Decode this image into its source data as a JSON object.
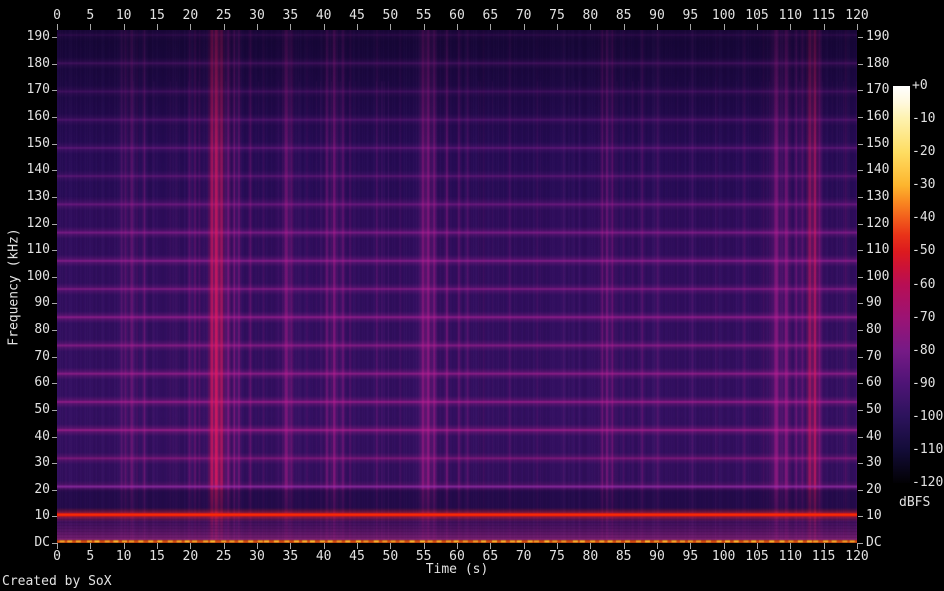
{
  "footer": {
    "credit": "Created by SoX"
  },
  "colors": {
    "background": "#000000",
    "text": "#e2e2e2",
    "tick": "#a8a8a8",
    "plot_background": "#2b0e5c",
    "band_magenta": "#d71e91",
    "hot_red_line": "#f71b07",
    "dc_orange": "#d94f0e",
    "dc_yellow_dash": "#ffcc33"
  },
  "axes": {
    "time": {
      "label": "Time (s)",
      "min": 0,
      "max": 120,
      "ticks": [
        0,
        5,
        10,
        15,
        20,
        25,
        30,
        35,
        40,
        45,
        50,
        55,
        60,
        65,
        70,
        75,
        80,
        85,
        90,
        95,
        100,
        105,
        110,
        115,
        120
      ]
    },
    "freq": {
      "label": "Frequency (kHz)",
      "min": 0,
      "max": 192.7,
      "ticks": [
        "190",
        "180",
        "170",
        "160",
        "150",
        "140",
        "130",
        "120",
        "110",
        "100",
        "90",
        "80",
        "70",
        "60",
        "50",
        "40",
        "30",
        "20",
        "10",
        "DC"
      ]
    }
  },
  "colorbar": {
    "label": "dBFS",
    "ticks": [
      "+0",
      "-10",
      "-20",
      "-30",
      "-40",
      "-50",
      "-60",
      "-70",
      "-80",
      "-90",
      "-100",
      "-110",
      "-120"
    ],
    "stops": [
      {
        "pos": 0.0,
        "color": "#ffffff"
      },
      {
        "pos": 0.042,
        "color": "#fff9dd"
      },
      {
        "pos": 0.083,
        "color": "#fef2ae"
      },
      {
        "pos": 0.167,
        "color": "#fedd62"
      },
      {
        "pos": 0.25,
        "color": "#fdb52e"
      },
      {
        "pos": 0.292,
        "color": "#f98821"
      },
      {
        "pos": 0.333,
        "color": "#f25d1c"
      },
      {
        "pos": 0.375,
        "color": "#e93318"
      },
      {
        "pos": 0.417,
        "color": "#dc1a1e"
      },
      {
        "pos": 0.458,
        "color": "#cb1238"
      },
      {
        "pos": 0.5,
        "color": "#b80e54"
      },
      {
        "pos": 0.583,
        "color": "#9c1374"
      },
      {
        "pos": 0.667,
        "color": "#761a86"
      },
      {
        "pos": 0.75,
        "color": "#4e1476"
      },
      {
        "pos": 0.833,
        "color": "#2c135c"
      },
      {
        "pos": 0.917,
        "color": "#130c38"
      },
      {
        "pos": 1.0,
        "color": "#020104"
      }
    ]
  },
  "chart_data": {
    "type": "heatmap",
    "subtype": "spectrogram",
    "title": "",
    "xlabel": "Time (s)",
    "ylabel": "Frequency (kHz)",
    "xlim": [
      0,
      120
    ],
    "ylim": [
      0,
      192.7
    ],
    "color_scale": {
      "unit": "dBFS",
      "min": -120,
      "max": 0
    },
    "spectrogram": {
      "background_level_dbfs": -100,
      "harmonic_fundamental_khz": 10.6,
      "harmonic_count": 18,
      "harmonic_intensity": [
        0,
        0.5,
        0.6,
        0.85,
        0.8,
        0.8,
        0.75,
        0.85,
        0.7,
        0.8,
        0.75,
        0.6,
        0.45,
        0.5,
        0.45,
        0.4,
        0.5,
        0.3
      ],
      "strong_line_khz": 10.6,
      "dc_line": true,
      "noise_floor_rise_below_khz": 22,
      "events": [
        {
          "t": 9.7,
          "w": 1.5,
          "a": 0.22
        },
        {
          "t": 10.3,
          "w": 1.5,
          "a": 0.28
        },
        {
          "t": 11.2,
          "w": 2,
          "a": 0.34
        },
        {
          "t": 12.0,
          "w": 1,
          "a": 0.18
        },
        {
          "t": 13.1,
          "w": 1.5,
          "a": 0.3
        },
        {
          "t": 17.4,
          "w": 4,
          "a": 0.1,
          "soft": 1
        },
        {
          "t": 19.9,
          "w": 1.5,
          "a": 0.26
        },
        {
          "t": 20.7,
          "w": 1.5,
          "a": 0.3
        },
        {
          "t": 21.4,
          "w": 1,
          "a": 0.22
        },
        {
          "t": 24.0,
          "w": 10,
          "a": 0.12,
          "soft": 1
        },
        {
          "t": 23.2,
          "w": 2.5,
          "a": 0.7,
          "hot": 1
        },
        {
          "t": 23.9,
          "w": 3,
          "a": 0.85,
          "hot": 1
        },
        {
          "t": 24.7,
          "w": 2.5,
          "a": 0.6,
          "hot": 1
        },
        {
          "t": 25.7,
          "w": 2,
          "a": 0.5
        },
        {
          "t": 26.6,
          "w": 1.5,
          "a": 0.45
        },
        {
          "t": 27.3,
          "w": 1.5,
          "a": 0.4
        },
        {
          "t": 29.0,
          "w": 1.5,
          "a": 0.3
        },
        {
          "t": 31.0,
          "w": 1,
          "a": 0.15
        },
        {
          "t": 34.5,
          "w": 8,
          "a": 0.1,
          "soft": 1
        },
        {
          "t": 34.4,
          "w": 3,
          "a": 0.45
        },
        {
          "t": 35.2,
          "w": 1.5,
          "a": 0.3
        },
        {
          "t": 37.5,
          "w": 1,
          "a": 0.15
        },
        {
          "t": 41.5,
          "w": 9,
          "a": 0.1,
          "soft": 1
        },
        {
          "t": 40.5,
          "w": 1.5,
          "a": 0.38
        },
        {
          "t": 41.6,
          "w": 2.5,
          "a": 0.45
        },
        {
          "t": 42.9,
          "w": 1.5,
          "a": 0.35
        },
        {
          "t": 44.0,
          "w": 1,
          "a": 0.2
        },
        {
          "t": 48.0,
          "w": 1.5,
          "a": 0.18
        },
        {
          "t": 51.5,
          "w": 1,
          "a": 0.12
        },
        {
          "t": 56.0,
          "w": 10,
          "a": 0.1,
          "soft": 1
        },
        {
          "t": 54.9,
          "w": 2.5,
          "a": 0.5
        },
        {
          "t": 55.7,
          "w": 2.5,
          "a": 0.55
        },
        {
          "t": 56.6,
          "w": 2,
          "a": 0.45
        },
        {
          "t": 58.5,
          "w": 1.5,
          "a": 0.42
        },
        {
          "t": 60.3,
          "w": 1.5,
          "a": 0.28
        },
        {
          "t": 61.6,
          "w": 1.5,
          "a": 0.22
        },
        {
          "t": 64.0,
          "w": 1,
          "a": 0.12
        },
        {
          "t": 67.9,
          "w": 1.5,
          "a": 0.16
        },
        {
          "t": 72.0,
          "w": 1,
          "a": 0.1
        },
        {
          "t": 76.0,
          "w": 1,
          "a": 0.1
        },
        {
          "t": 82.5,
          "w": 8,
          "a": 0.08,
          "soft": 1
        },
        {
          "t": 81.8,
          "w": 1.5,
          "a": 0.36
        },
        {
          "t": 82.5,
          "w": 1.5,
          "a": 0.42
        },
        {
          "t": 83.3,
          "w": 1.5,
          "a": 0.36
        },
        {
          "t": 85.0,
          "w": 1,
          "a": 0.15
        },
        {
          "t": 87.8,
          "w": 1.5,
          "a": 0.24
        },
        {
          "t": 90.1,
          "w": 1.5,
          "a": 0.18
        },
        {
          "t": 95.3,
          "w": 1,
          "a": 0.14
        },
        {
          "t": 99.0,
          "w": 1,
          "a": 0.1
        },
        {
          "t": 103.1,
          "w": 1.5,
          "a": 0.18
        },
        {
          "t": 106.0,
          "w": 1,
          "a": 0.14
        },
        {
          "t": 109.0,
          "w": 12,
          "a": 0.12,
          "soft": 1
        },
        {
          "t": 107.9,
          "w": 4,
          "a": 0.5
        },
        {
          "t": 109.4,
          "w": 3,
          "a": 0.45
        },
        {
          "t": 110.9,
          "w": 1.5,
          "a": 0.32
        },
        {
          "t": 111.8,
          "w": 1.5,
          "a": 0.3
        },
        {
          "t": 113.5,
          "w": 8,
          "a": 0.12,
          "soft": 1
        },
        {
          "t": 112.9,
          "w": 2.5,
          "a": 0.55,
          "hot": 1
        },
        {
          "t": 113.7,
          "w": 2.5,
          "a": 0.65,
          "hot": 1
        },
        {
          "t": 114.4,
          "w": 1.5,
          "a": 0.45
        },
        {
          "t": 118.3,
          "w": 1.5,
          "a": 0.18
        }
      ]
    }
  }
}
